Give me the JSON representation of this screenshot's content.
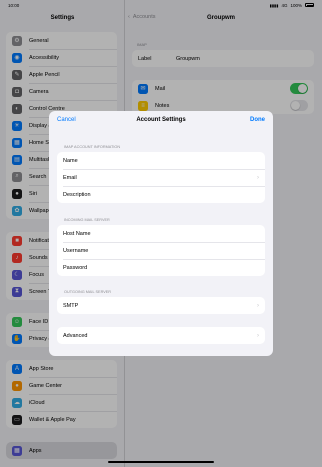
{
  "status": {
    "time": "10:00",
    "network": "4G",
    "battery": "100%"
  },
  "sidebar": {
    "title": "Settings",
    "group1": [
      {
        "label": "General",
        "icon": "gear-icon",
        "color": "#8e8e93"
      },
      {
        "label": "Accessibility",
        "icon": "accessibility-icon",
        "color": "#007aff"
      },
      {
        "label": "Apple Pencil",
        "icon": "pencil-icon",
        "color": "#636366"
      },
      {
        "label": "Camera",
        "icon": "camera-icon",
        "color": "#636366"
      },
      {
        "label": "Control Centre",
        "icon": "control-centre-icon",
        "color": "#636366"
      },
      {
        "label": "Display & Brightness",
        "icon": "display-icon",
        "color": "#007aff"
      },
      {
        "label": "Home Screen & App Library",
        "icon": "home-screen-icon",
        "color": "#007aff"
      },
      {
        "label": "Multitasking & Gestures",
        "icon": "multitasking-icon",
        "color": "#007aff"
      },
      {
        "label": "Search",
        "icon": "search-icon",
        "color": "#8e8e93"
      },
      {
        "label": "Siri",
        "icon": "siri-icon",
        "color": "#1c1c1e"
      },
      {
        "label": "Wallpaper",
        "icon": "wallpaper-icon",
        "color": "#32ade6"
      }
    ],
    "group2": [
      {
        "label": "Notifications",
        "icon": "notifications-icon",
        "color": "#ff3b30"
      },
      {
        "label": "Sounds",
        "icon": "sounds-icon",
        "color": "#ff3b30"
      },
      {
        "label": "Focus",
        "icon": "focus-icon",
        "color": "#5856d6"
      },
      {
        "label": "Screen Time",
        "icon": "screen-time-icon",
        "color": "#5856d6"
      }
    ],
    "group3": [
      {
        "label": "Face ID & Passcode",
        "icon": "face-id-icon",
        "color": "#34c759"
      },
      {
        "label": "Privacy & Security",
        "icon": "privacy-icon",
        "color": "#007aff"
      }
    ],
    "group4": [
      {
        "label": "App Store",
        "icon": "app-store-icon",
        "color": "#007aff"
      },
      {
        "label": "Game Center",
        "icon": "game-center-icon",
        "color": "#ff9500"
      },
      {
        "label": "iCloud",
        "icon": "icloud-icon",
        "color": "#32ade6"
      },
      {
        "label": "Wallet & Apple Pay",
        "icon": "wallet-icon",
        "color": "#1c1c1e"
      }
    ],
    "group5": [
      {
        "label": "Apps",
        "icon": "apps-icon",
        "color": "#5856d6"
      }
    ]
  },
  "detail": {
    "back": "Accounts",
    "title": "Groupwm",
    "section_caption": "IMAP",
    "label_key": "Label",
    "label_value": "Groupwm",
    "mail": "Mail",
    "notes": "Notes"
  },
  "modal": {
    "cancel": "Cancel",
    "title": "Account Settings",
    "done": "Done",
    "imap_caption": "IMAP ACCOUNT INFORMATION",
    "imap_rows": [
      "Name",
      "Email",
      "Description"
    ],
    "incoming_caption": "INCOMING MAIL SERVER",
    "incoming_rows": [
      "Host Name",
      "Username",
      "Password"
    ],
    "outgoing_caption": "OUTGOING MAIL SERVER",
    "smtp": "SMTP",
    "advanced": "Advanced"
  }
}
